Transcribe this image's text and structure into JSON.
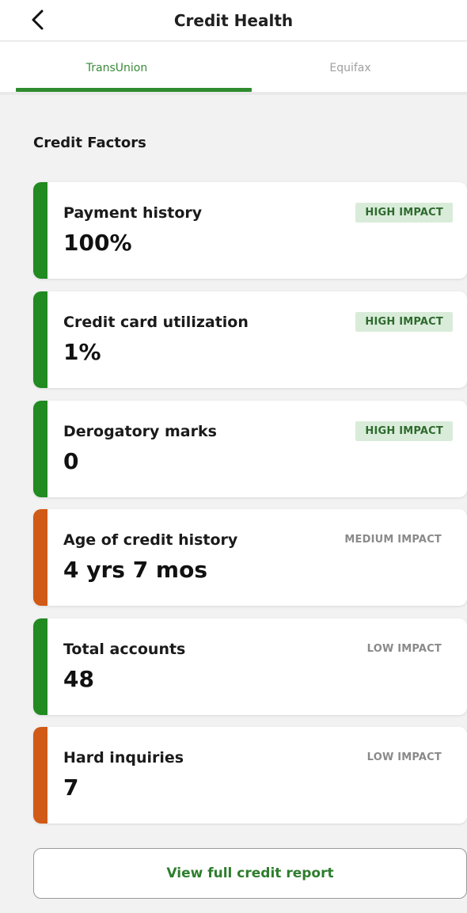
{
  "header": {
    "title": "Credit Health",
    "back_icon": "chevron-left-icon"
  },
  "tabs": [
    {
      "label": "TransUnion",
      "active": true
    },
    {
      "label": "Equifax",
      "active": false
    }
  ],
  "section_title": "Credit Factors",
  "colors": {
    "good": "#218a21",
    "warn": "#d05a16",
    "badge_bg": "#d9ecd9"
  },
  "factors": [
    {
      "label": "Payment history",
      "value": "100%",
      "impact": "HIGH IMPACT",
      "status": "good"
    },
    {
      "label": "Credit card utilization",
      "value": "1%",
      "impact": "HIGH IMPACT",
      "status": "good"
    },
    {
      "label": "Derogatory marks",
      "value": "0",
      "impact": "HIGH IMPACT",
      "status": "good"
    },
    {
      "label": "Age of credit history",
      "value": "4 yrs 7 mos",
      "impact": "MEDIUM IMPACT",
      "status": "warn"
    },
    {
      "label": "Total accounts",
      "value": "48",
      "impact": "LOW IMPACT",
      "status": "good"
    },
    {
      "label": "Hard inquiries",
      "value": "7",
      "impact": "LOW IMPACT",
      "status": "warn"
    }
  ],
  "cta": {
    "label": "View full credit report"
  }
}
